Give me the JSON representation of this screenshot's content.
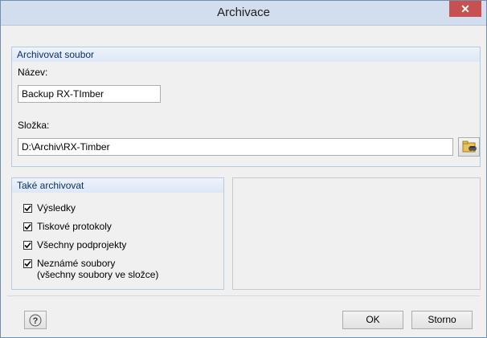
{
  "window": {
    "title": "Archivace",
    "close_icon": "close-icon"
  },
  "archive_file": {
    "group_title": "Archivovat soubor",
    "name_label": "Název:",
    "name_value": "Backup RX-TImber",
    "folder_label": "Složka:",
    "folder_value": "D:\\Archiv\\RX-Timber",
    "browse_icon": "folder-browse-icon"
  },
  "also_archive": {
    "group_title": "Také archivovat",
    "items": [
      {
        "label": "Výsledky",
        "checked": true
      },
      {
        "label": "Tiskové protokoly",
        "checked": true
      },
      {
        "label": "Všechny podprojekty",
        "checked": true
      },
      {
        "label": "Neznámé soubory",
        "label2": "(všechny soubory ve složce)",
        "checked": true
      }
    ]
  },
  "footer": {
    "help_icon": "help-icon",
    "ok_label": "OK",
    "cancel_label": "Storno"
  },
  "colors": {
    "accent": "#0d2f66",
    "close": "#c75050",
    "titlebar": "#d2deed"
  }
}
